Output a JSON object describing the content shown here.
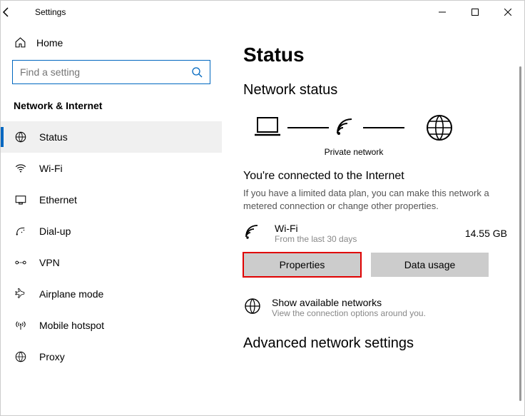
{
  "titlebar": {
    "title": "Settings"
  },
  "sidebar": {
    "home": "Home",
    "search_placeholder": "Find a setting",
    "group": "Network & Internet",
    "items": [
      {
        "label": "Status"
      },
      {
        "label": "Wi-Fi"
      },
      {
        "label": "Ethernet"
      },
      {
        "label": "Dial-up"
      },
      {
        "label": "VPN"
      },
      {
        "label": "Airplane mode"
      },
      {
        "label": "Mobile hotspot"
      },
      {
        "label": "Proxy"
      }
    ]
  },
  "main": {
    "title": "Status",
    "status_heading": "Network status",
    "diagram_caption": "Private network",
    "connected_heading": "You're connected to the Internet",
    "connected_desc": "If you have a limited data plan, you can make this network a metered connection or change other properties.",
    "conn_name": "Wi-Fi",
    "conn_sub": "From the last 30 days",
    "conn_size": "14.55 GB",
    "properties_btn": "Properties",
    "datausage_btn": "Data usage",
    "available_title": "Show available networks",
    "available_sub": "View the connection options around you.",
    "advanced_heading": "Advanced network settings"
  }
}
